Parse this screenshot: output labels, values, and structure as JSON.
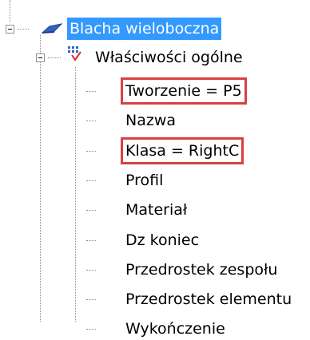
{
  "tree": {
    "root": {
      "label": "Blacha wieloboczna",
      "icon": "plate-icon",
      "selected": true
    },
    "group": {
      "label": "Właściwości ogólne",
      "icon": "properties-icon"
    },
    "items": [
      {
        "label": "Tworzenie = P5",
        "highlighted": true
      },
      {
        "label": "Nazwa",
        "highlighted": false
      },
      {
        "label": "Klasa = RightC",
        "highlighted": true
      },
      {
        "label": "Profil",
        "highlighted": false
      },
      {
        "label": "Materiał",
        "highlighted": false
      },
      {
        "label": "Dz koniec",
        "highlighted": false
      },
      {
        "label": "Przedrostek zespołu",
        "highlighted": false
      },
      {
        "label": "Przedrostek elementu",
        "highlighted": false
      },
      {
        "label": "Wykończenie",
        "highlighted": false
      }
    ]
  },
  "colors": {
    "selection": "#3399ff",
    "highlight_border": "#d94040",
    "connector": "#8c8c8c"
  }
}
